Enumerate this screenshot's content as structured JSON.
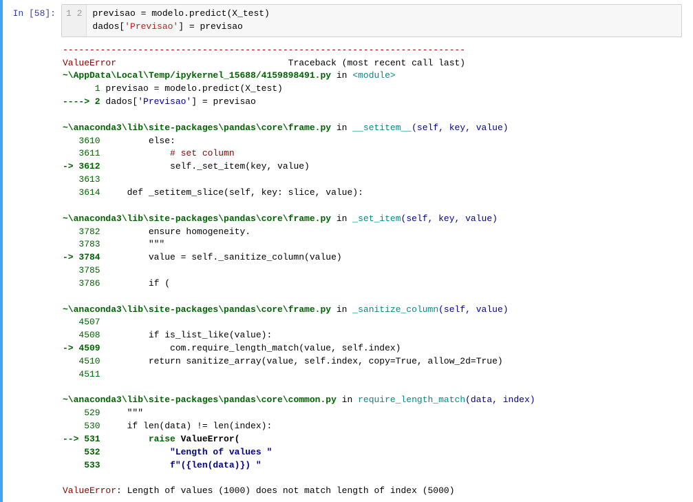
{
  "prompt": "In [58]:",
  "code": {
    "gutter": "1\n2",
    "line1a": "previsao = modelo.predict(X_test)",
    "line2a": "dados[",
    "line2b": "'Previsao'",
    "line2c": "] = previsao"
  },
  "out": {
    "dash": "---------------------------------------------------------------------------",
    "err_name": "ValueError",
    "tb_label": "                                Traceback (most recent call last)",
    "loc1_pre": "~\\AppData\\Local\\Temp/ipykernel_15688/4159898491.py",
    "loc1_in": " in ",
    "loc1_func": "<module>",
    "l1a": "      1",
    "l1b": " previsao = modelo.predict(X_test)",
    "l2a": "----> 2",
    "l2b": " dados[",
    "l2c": "'Previsao'",
    "l2d": "] = previsao",
    "loc2_pre": "~\\anaconda3\\lib\\site-packages\\pandas\\core\\frame.py",
    "loc2_in": " in ",
    "loc2_func": "__setitem__",
    "loc2_args": "(self, key, value)",
    "f2_3610n": "   3610",
    "f2_3610t": "         else:",
    "f2_3611n": "   3611",
    "f2_3611t": "             # set column",
    "f2_3612a": "-> 3612",
    "f2_3612t": "             self._set_item(key, value)",
    "f2_3613n": "   3613",
    "f2_3614n": "   3614",
    "f2_3614t": "     def _setitem_slice(self, key: slice, value):",
    "loc3_pre": "~\\anaconda3\\lib\\site-packages\\pandas\\core\\frame.py",
    "loc3_in": " in ",
    "loc3_func": "_set_item",
    "loc3_args": "(self, key, value)",
    "f3_3782n": "   3782",
    "f3_3782t": "         ensure homogeneity.",
    "f3_3783n": "   3783",
    "f3_3783t": "         \"\"\"",
    "f3_3784a": "-> 3784",
    "f3_3784t": "         value = self._sanitize_column(value)",
    "f3_3785n": "   3785",
    "f3_3786n": "   3786",
    "f3_3786t": "         if (",
    "loc4_pre": "~\\anaconda3\\lib\\site-packages\\pandas\\core\\frame.py",
    "loc4_in": " in ",
    "loc4_func": "_sanitize_column",
    "loc4_args": "(self, value)",
    "f4_4507n": "   4507",
    "f4_4508n": "   4508",
    "f4_4508t": "         if is_list_like(value):",
    "f4_4509a": "-> 4509",
    "f4_4509t": "             com.require_length_match(value, self.index)",
    "f4_4510n": "   4510",
    "f4_4510t": "         return sanitize_array(value, self.index, copy=True, allow_2d=True)",
    "f4_4511n": "   4511",
    "loc5_pre": "~\\anaconda3\\lib\\site-packages\\pandas\\core\\common.py",
    "loc5_in": " in ",
    "loc5_func": "require_length_match",
    "loc5_args": "(data, index)",
    "f5_529n": "    529",
    "f5_529t": "     \"\"\"",
    "f5_530n": "    530",
    "f5_530t": "     if len(data) != len(index):",
    "f5_531a": "--> 531",
    "f5_531t1": "         raise",
    "f5_531t2": " ValueError(",
    "f5_532n": "    532",
    "f5_532t": "             \"Length of values \"",
    "f5_533n": "    533",
    "f5_533t": "             f\"({len(data)}) \"",
    "final_err": "ValueError",
    "final_msg": ": Length of values (1000) does not match length of index (5000)"
  }
}
